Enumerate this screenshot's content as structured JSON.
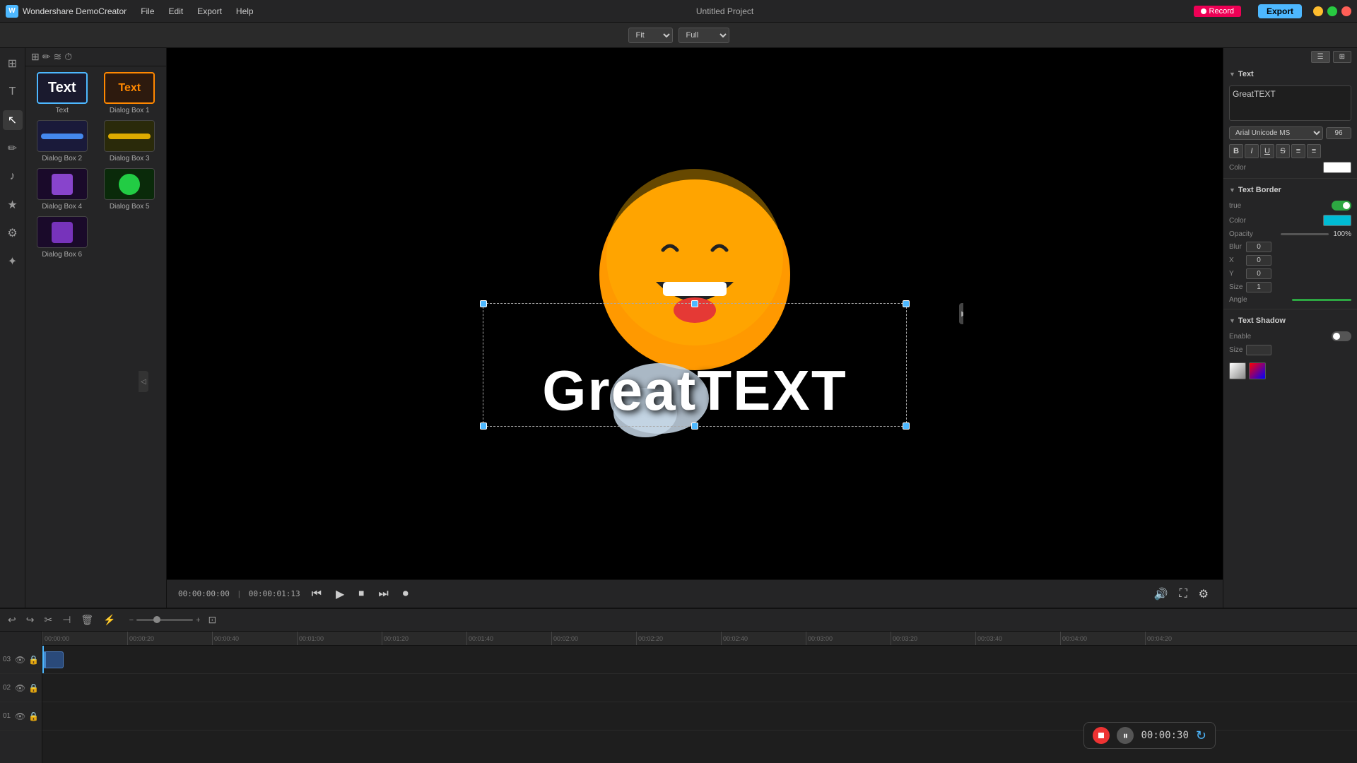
{
  "app": {
    "name": "Wondershare DemoCreator",
    "title": "Untitled Project",
    "logo_text": "W"
  },
  "topbar": {
    "menu": [
      "File",
      "Edit",
      "Export",
      "Help"
    ],
    "record_label": "Record",
    "export_label": "Export",
    "window_controls": [
      "minimize",
      "maximize",
      "close"
    ]
  },
  "toolbar2": {
    "fit_label": "Fit",
    "full_label": "Full"
  },
  "media_panel": {
    "items": [
      {
        "id": 1,
        "label": "Text",
        "type": "text-white"
      },
      {
        "id": 2,
        "label": "Dialog Box 1",
        "type": "text-orange"
      },
      {
        "id": 3,
        "label": "Dialog Box 2",
        "type": "blue-bar"
      },
      {
        "id": 4,
        "label": "Dialog Box 3",
        "type": "yellow-bar"
      },
      {
        "id": 5,
        "label": "Dialog Box 4",
        "type": "purple-box"
      },
      {
        "id": 6,
        "label": "Dialog Box 5",
        "type": "green-circle"
      },
      {
        "id": 7,
        "label": "Dialog Box 6",
        "type": "purple-box2"
      }
    ]
  },
  "preview": {
    "canvas_text": "GreatTEXT",
    "emoji": "😄"
  },
  "playback": {
    "current_time": "00:00:00:00",
    "total_time": "00:00:01:13"
  },
  "right_panel": {
    "section_text": "Text",
    "text_content": "GreatTEXT",
    "font_family": "Arial Unicode MS",
    "font_size": "96",
    "format_buttons": [
      "B",
      "I",
      "U",
      "S",
      "≡",
      "≡"
    ],
    "color_label": "Color",
    "border_section": "Text Border",
    "border_enable": true,
    "border_color_label": "Color",
    "border_opacity_label": "Opacity",
    "border_opacity_val": "100%",
    "blur_label": "Blur",
    "blur_val": "0",
    "x_label": "X",
    "x_val": "0",
    "y_label": "Y",
    "y_val": "0",
    "size_label": "Size",
    "size_val": "1",
    "angle_label": "Angle",
    "shadow_section": "Text Shadow",
    "shadow_enable": false
  },
  "timeline": {
    "ruler_marks": [
      "00:00:00:00",
      "00:00:20:00",
      "00:00:40:00",
      "00:01:00:00",
      "00:01:20:00",
      "00:01:40:00",
      "00:02:00:00",
      "00:02:20:00",
      "00:02:40:00",
      "00:03:00:00",
      "00:03:20:00",
      "00:03:40:00",
      "00:04:00:00",
      "00:04:20:00"
    ],
    "tracks": [
      {
        "id": "03",
        "has_clip": true,
        "clip_start": 0,
        "clip_width": 6
      },
      {
        "id": "02",
        "has_clip": false
      },
      {
        "id": "01",
        "has_clip": false
      }
    ]
  },
  "recording_widget": {
    "time": "00:00:30"
  }
}
